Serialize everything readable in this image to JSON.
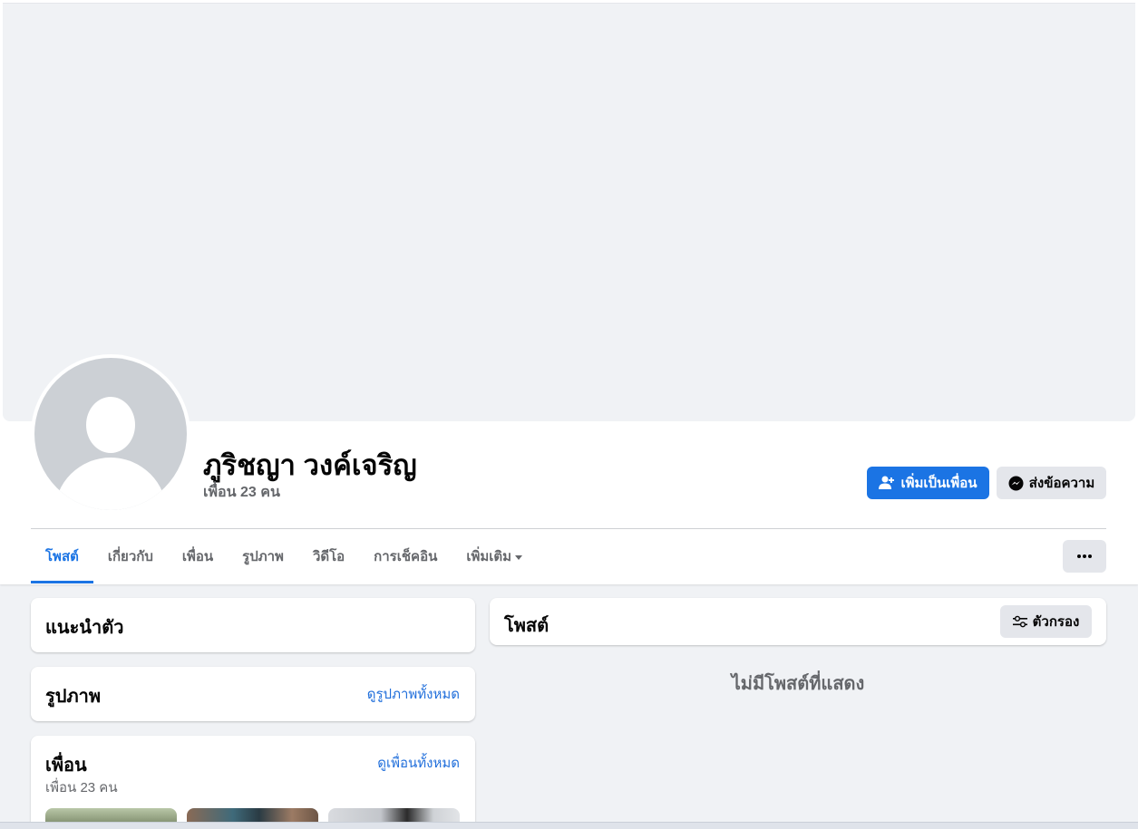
{
  "profile": {
    "name": "ภูริชญา วงค์เจริญ",
    "friend_count": "เพื่อน 23 คน"
  },
  "actions": {
    "add_friend": "เพิ่มเป็นเพื่อน",
    "message": "ส่งข้อความ"
  },
  "tabs": [
    {
      "label": "โพสต์",
      "active": true
    },
    {
      "label": "เกี่ยวกับ"
    },
    {
      "label": "เพื่อน"
    },
    {
      "label": "รูปภาพ"
    },
    {
      "label": "วิดีโอ"
    },
    {
      "label": "การเช็คอิน"
    },
    {
      "label": "เพิ่มเติม"
    }
  ],
  "intro": {
    "title": "แนะนำตัว"
  },
  "photos": {
    "title": "รูปภาพ",
    "link": "ดูรูปภาพทั้งหมด"
  },
  "friends": {
    "title": "เพื่อน",
    "link": "ดูเพื่อนทั้งหมด",
    "count": "เพื่อน 23 คน"
  },
  "posts": {
    "title": "โพสต์",
    "filter": "ตัวกรอง",
    "empty": "ไม่มีโพสต์ที่แสดง"
  },
  "colors": {
    "accent": "#1b74e4",
    "background": "#f0f2f5"
  },
  "icons": {
    "add_friend": "add-friend-icon",
    "message": "messenger-icon",
    "filter": "filter-sliders-icon",
    "more": "more-dots-icon",
    "dropdown": "caret-down-icon"
  }
}
